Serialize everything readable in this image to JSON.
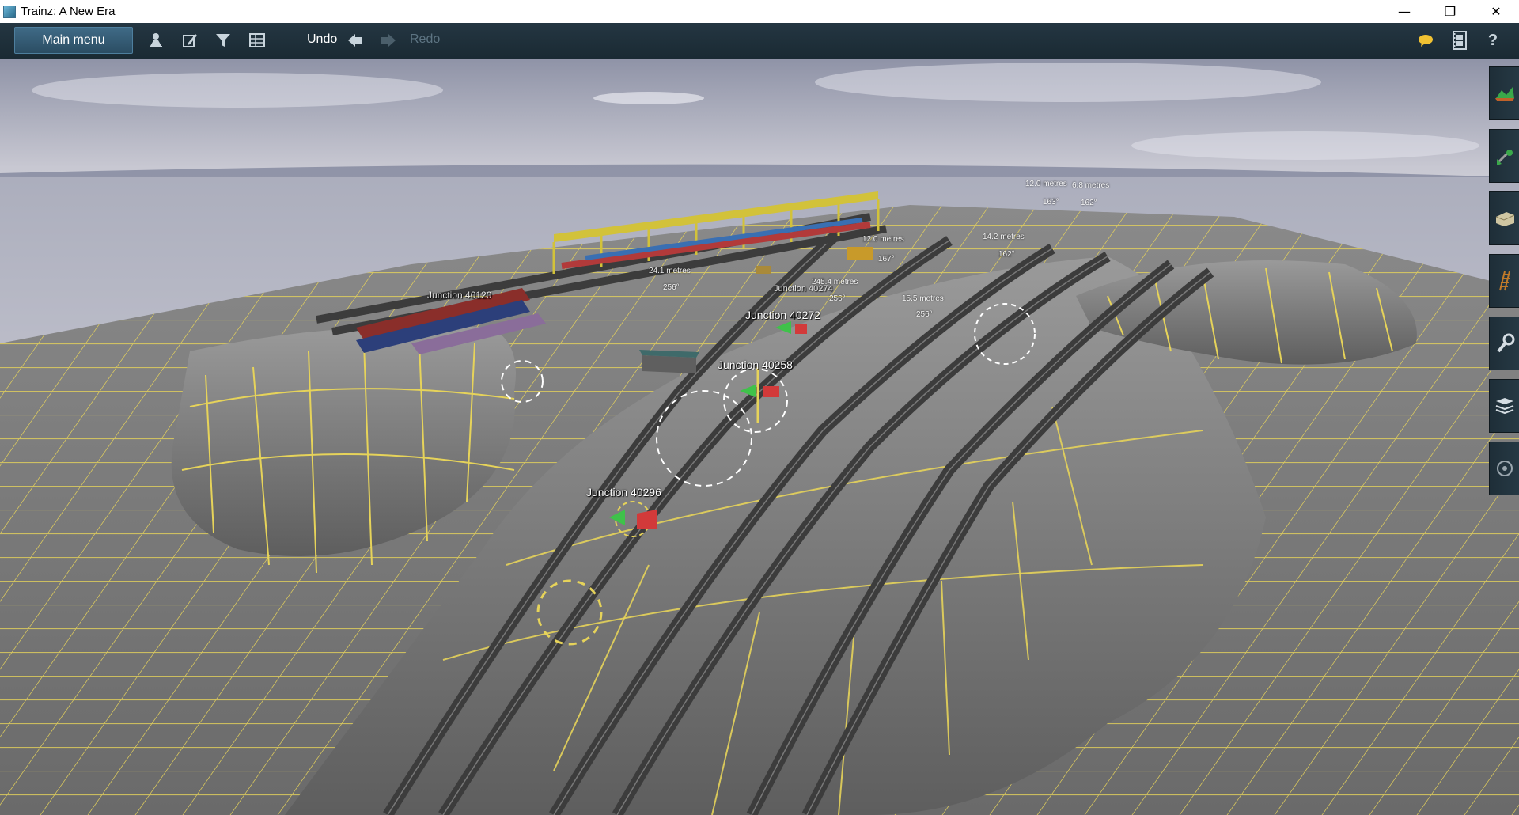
{
  "window": {
    "title": "Trainz: A New Era",
    "minimize": "—",
    "restore": "❐",
    "close": "✕"
  },
  "toolbar": {
    "main_menu": "Main menu",
    "undo": "Undo",
    "redo": "Redo",
    "icons": [
      "person-icon",
      "edit-icon",
      "filter-icon",
      "grid-icon"
    ],
    "right_icons": [
      "chat-icon",
      "film-icon",
      "help-icon"
    ],
    "help": "?"
  },
  "scene": {
    "junctions": [
      {
        "label": "Junction 40296"
      },
      {
        "label": "Junction 40258"
      },
      {
        "label": "Junction 40272"
      },
      {
        "label": "Junction 40120"
      },
      {
        "label": "Junction 40274"
      }
    ],
    "measurements": [
      {
        "label": "12.0 metres"
      },
      {
        "label": "24.1 metres"
      },
      {
        "label": "245.4 metres"
      },
      {
        "label": "14.2 metres"
      },
      {
        "label": "15.5 metres"
      },
      {
        "label": "12.0 metres"
      },
      {
        "label": "6.8 metres"
      }
    ],
    "angles": [
      "167°",
      "256°",
      "256°",
      "162°",
      "256°",
      "163°",
      "162°"
    ],
    "colors": {
      "sky_top": "#8f93a7",
      "sky_bottom": "#d9d9e1",
      "ground": "#6f6f6f",
      "grid_line": "#e6d35a",
      "track": "#4a4a4a"
    }
  },
  "side_panel": {
    "items": [
      {
        "name": "terrain-tool-icon"
      },
      {
        "name": "paint-tool-icon"
      },
      {
        "name": "objects-tool-icon"
      },
      {
        "name": "track-tool-icon"
      },
      {
        "name": "settings-tool-icon"
      },
      {
        "name": "layers-tool-icon"
      },
      {
        "name": "camera-tool-icon"
      }
    ]
  }
}
